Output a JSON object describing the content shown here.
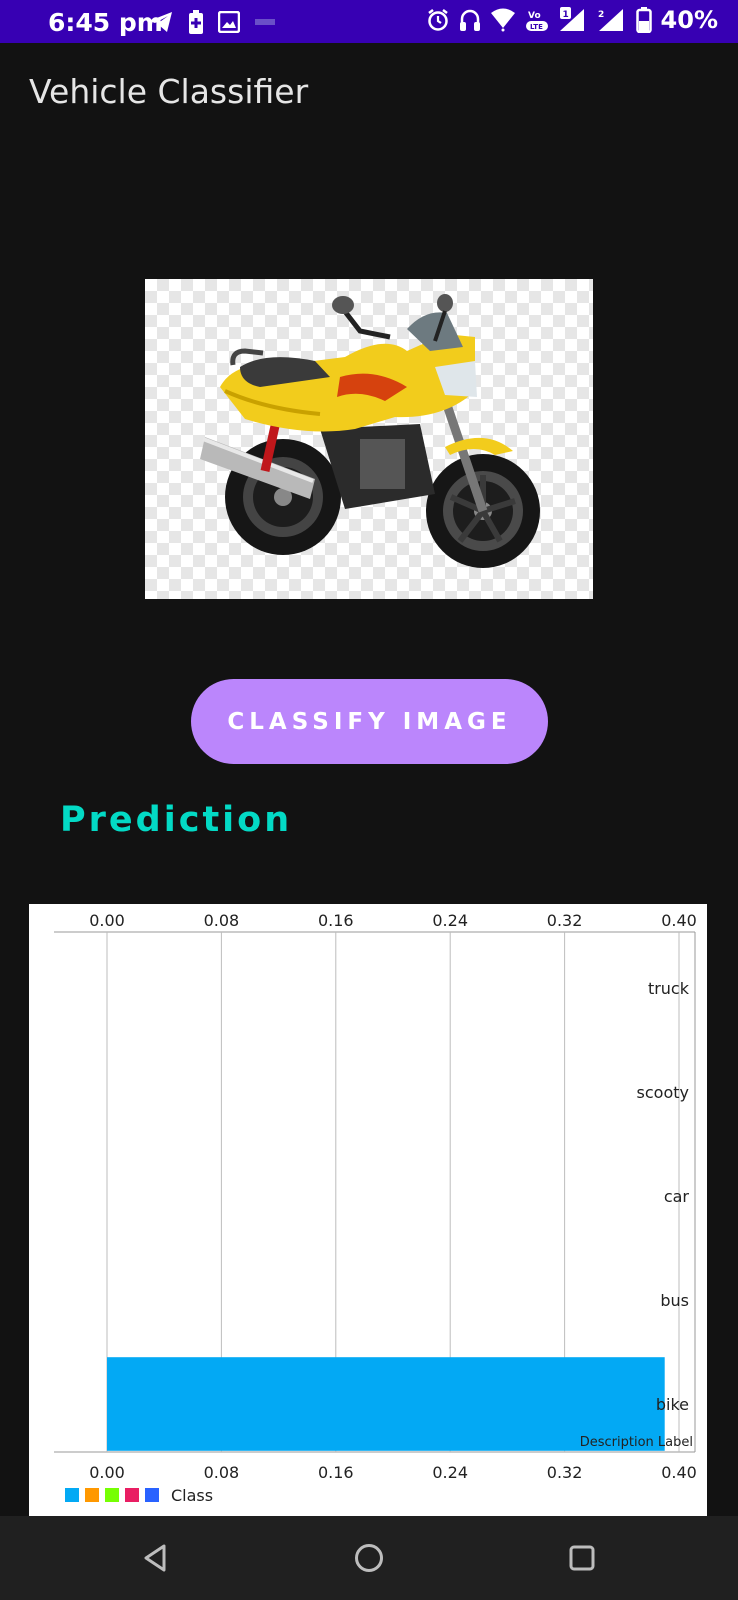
{
  "status_bar": {
    "time": "6:45 pm",
    "battery_percent": "40%",
    "icons": [
      "telegram-icon",
      "battery-saver-icon",
      "gallery-icon",
      "alarm-icon",
      "headphones-icon",
      "wifi-icon",
      "volte-icon",
      "signal-sim1-icon",
      "signal-sim2-icon",
      "battery-icon"
    ]
  },
  "app_bar": {
    "title": "Vehicle Classifier"
  },
  "classify_button": {
    "label": "CLASSIFY IMAGE"
  },
  "prediction": {
    "title": "Prediction"
  },
  "colors": {
    "status_bar": "#3700b3",
    "background": "#121212",
    "button": "#bb86fc",
    "prediction_title": "#03dac5",
    "bar": "#03a9f4",
    "legend": [
      "#03a9f4",
      "#ff9800",
      "#76ff03",
      "#e91e63",
      "#2962ff"
    ]
  },
  "chart_data": {
    "type": "bar",
    "orientation": "horizontal",
    "categories": [
      "truck",
      "scooty",
      "car",
      "bus",
      "bike"
    ],
    "values": [
      0,
      0,
      0,
      0,
      0.39
    ],
    "xlim": [
      0,
      0.4
    ],
    "x_ticks": [
      "0.00",
      "0.08",
      "0.16",
      "0.24",
      "0.32",
      "0.40"
    ],
    "description_label": "Description Label",
    "legend": {
      "label": "Class",
      "position": "bottom-left"
    },
    "grid": true
  },
  "nav_bar": {
    "buttons": [
      "back-icon",
      "home-icon",
      "recents-icon"
    ]
  }
}
